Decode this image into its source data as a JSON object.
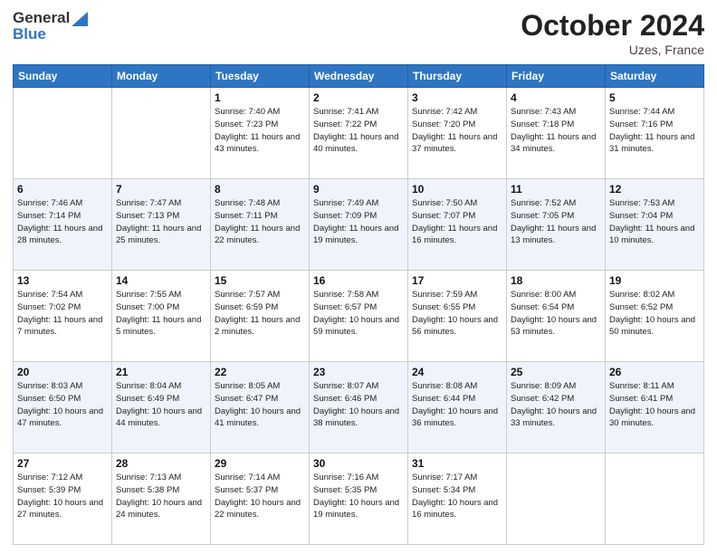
{
  "header": {
    "logo_line1": "General",
    "logo_line2": "Blue",
    "month": "October 2024",
    "location": "Uzes, France"
  },
  "weekdays": [
    "Sunday",
    "Monday",
    "Tuesday",
    "Wednesday",
    "Thursday",
    "Friday",
    "Saturday"
  ],
  "weeks": [
    [
      {
        "day": "",
        "info": ""
      },
      {
        "day": "",
        "info": ""
      },
      {
        "day": "1",
        "info": "Sunrise: 7:40 AM\nSunset: 7:23 PM\nDaylight: 11 hours and 43 minutes."
      },
      {
        "day": "2",
        "info": "Sunrise: 7:41 AM\nSunset: 7:22 PM\nDaylight: 11 hours and 40 minutes."
      },
      {
        "day": "3",
        "info": "Sunrise: 7:42 AM\nSunset: 7:20 PM\nDaylight: 11 hours and 37 minutes."
      },
      {
        "day": "4",
        "info": "Sunrise: 7:43 AM\nSunset: 7:18 PM\nDaylight: 11 hours and 34 minutes."
      },
      {
        "day": "5",
        "info": "Sunrise: 7:44 AM\nSunset: 7:16 PM\nDaylight: 11 hours and 31 minutes."
      }
    ],
    [
      {
        "day": "6",
        "info": "Sunrise: 7:46 AM\nSunset: 7:14 PM\nDaylight: 11 hours and 28 minutes."
      },
      {
        "day": "7",
        "info": "Sunrise: 7:47 AM\nSunset: 7:13 PM\nDaylight: 11 hours and 25 minutes."
      },
      {
        "day": "8",
        "info": "Sunrise: 7:48 AM\nSunset: 7:11 PM\nDaylight: 11 hours and 22 minutes."
      },
      {
        "day": "9",
        "info": "Sunrise: 7:49 AM\nSunset: 7:09 PM\nDaylight: 11 hours and 19 minutes."
      },
      {
        "day": "10",
        "info": "Sunrise: 7:50 AM\nSunset: 7:07 PM\nDaylight: 11 hours and 16 minutes."
      },
      {
        "day": "11",
        "info": "Sunrise: 7:52 AM\nSunset: 7:05 PM\nDaylight: 11 hours and 13 minutes."
      },
      {
        "day": "12",
        "info": "Sunrise: 7:53 AM\nSunset: 7:04 PM\nDaylight: 11 hours and 10 minutes."
      }
    ],
    [
      {
        "day": "13",
        "info": "Sunrise: 7:54 AM\nSunset: 7:02 PM\nDaylight: 11 hours and 7 minutes."
      },
      {
        "day": "14",
        "info": "Sunrise: 7:55 AM\nSunset: 7:00 PM\nDaylight: 11 hours and 5 minutes."
      },
      {
        "day": "15",
        "info": "Sunrise: 7:57 AM\nSunset: 6:59 PM\nDaylight: 11 hours and 2 minutes."
      },
      {
        "day": "16",
        "info": "Sunrise: 7:58 AM\nSunset: 6:57 PM\nDaylight: 10 hours and 59 minutes."
      },
      {
        "day": "17",
        "info": "Sunrise: 7:59 AM\nSunset: 6:55 PM\nDaylight: 10 hours and 56 minutes."
      },
      {
        "day": "18",
        "info": "Sunrise: 8:00 AM\nSunset: 6:54 PM\nDaylight: 10 hours and 53 minutes."
      },
      {
        "day": "19",
        "info": "Sunrise: 8:02 AM\nSunset: 6:52 PM\nDaylight: 10 hours and 50 minutes."
      }
    ],
    [
      {
        "day": "20",
        "info": "Sunrise: 8:03 AM\nSunset: 6:50 PM\nDaylight: 10 hours and 47 minutes."
      },
      {
        "day": "21",
        "info": "Sunrise: 8:04 AM\nSunset: 6:49 PM\nDaylight: 10 hours and 44 minutes."
      },
      {
        "day": "22",
        "info": "Sunrise: 8:05 AM\nSunset: 6:47 PM\nDaylight: 10 hours and 41 minutes."
      },
      {
        "day": "23",
        "info": "Sunrise: 8:07 AM\nSunset: 6:46 PM\nDaylight: 10 hours and 38 minutes."
      },
      {
        "day": "24",
        "info": "Sunrise: 8:08 AM\nSunset: 6:44 PM\nDaylight: 10 hours and 36 minutes."
      },
      {
        "day": "25",
        "info": "Sunrise: 8:09 AM\nSunset: 6:42 PM\nDaylight: 10 hours and 33 minutes."
      },
      {
        "day": "26",
        "info": "Sunrise: 8:11 AM\nSunset: 6:41 PM\nDaylight: 10 hours and 30 minutes."
      }
    ],
    [
      {
        "day": "27",
        "info": "Sunrise: 7:12 AM\nSunset: 5:39 PM\nDaylight: 10 hours and 27 minutes."
      },
      {
        "day": "28",
        "info": "Sunrise: 7:13 AM\nSunset: 5:38 PM\nDaylight: 10 hours and 24 minutes."
      },
      {
        "day": "29",
        "info": "Sunrise: 7:14 AM\nSunset: 5:37 PM\nDaylight: 10 hours and 22 minutes."
      },
      {
        "day": "30",
        "info": "Sunrise: 7:16 AM\nSunset: 5:35 PM\nDaylight: 10 hours and 19 minutes."
      },
      {
        "day": "31",
        "info": "Sunrise: 7:17 AM\nSunset: 5:34 PM\nDaylight: 10 hours and 16 minutes."
      },
      {
        "day": "",
        "info": ""
      },
      {
        "day": "",
        "info": ""
      }
    ]
  ]
}
